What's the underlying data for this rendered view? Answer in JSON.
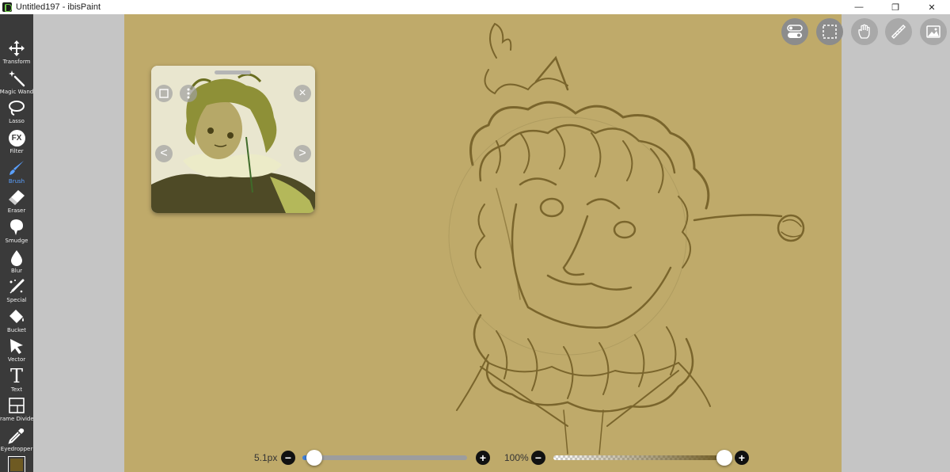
{
  "window": {
    "title": "Untitled197 - ibisPaint",
    "minimize": "—",
    "restore": "❐",
    "close": "✕"
  },
  "tools": [
    {
      "label": "Transform",
      "icon": "move-arrows-icon"
    },
    {
      "label": "Magic Wand",
      "icon": "magic-wand-icon"
    },
    {
      "label": "Lasso",
      "icon": "lasso-icon"
    },
    {
      "label": "Filter",
      "icon": "fx-icon"
    },
    {
      "label": "Brush",
      "icon": "brush-icon",
      "active": true
    },
    {
      "label": "Eraser",
      "icon": "eraser-icon"
    },
    {
      "label": "Smudge",
      "icon": "smudge-icon"
    },
    {
      "label": "Blur",
      "icon": "drop-icon"
    },
    {
      "label": "Special",
      "icon": "special-pen-icon"
    },
    {
      "label": "Bucket",
      "icon": "bucket-icon"
    },
    {
      "label": "Vector",
      "icon": "cursor-arrow-icon"
    },
    {
      "label": "Text",
      "icon": "text-t-icon"
    },
    {
      "label": "Frame Divider",
      "icon": "frame-divider-icon"
    },
    {
      "label": "Eyedropper",
      "icon": "eyedropper-icon"
    }
  ],
  "filter_icon_text": "FX",
  "text_icon_text": "T",
  "brush_size": {
    "label": "5.1px",
    "minus": "−",
    "plus": "+",
    "value_fraction": 0.05
  },
  "opacity": {
    "label": "100%",
    "minus": "−",
    "plus": "+",
    "value_fraction": 1.0
  },
  "reference_window": {
    "close": "×",
    "prev": "<",
    "next": ">"
  },
  "colors": {
    "canvas": "#bfaa6a",
    "toolbar": "#3a3a3a",
    "active_tool": "#5aa0ff",
    "brush_color": "#6e5a22"
  }
}
